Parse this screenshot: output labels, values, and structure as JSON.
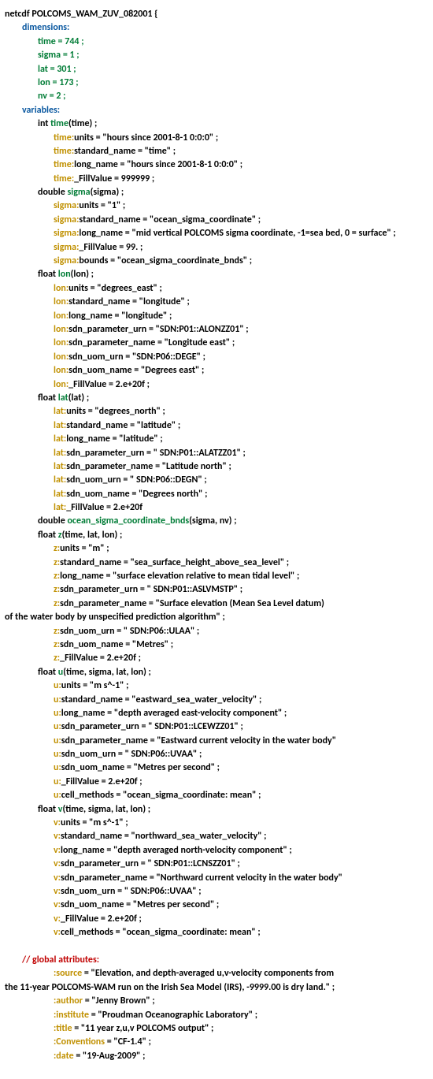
{
  "header": "netcdf POLCOMS_WAM_ZUV_082001 {",
  "section_dimensions": "dimensions:",
  "dims": {
    "time": "time = 744 ;",
    "sigma": "sigma = 1 ;",
    "lat": "lat = 301 ;",
    "lon": "lon = 173 ;",
    "nv": "nv = 2 ;"
  },
  "section_variables": "variables:",
  "vars": {
    "time_decl_prefix": "int ",
    "time_name": "time",
    "time_args": "(time) ;",
    "time_attrs": {
      "units_pref": "time:",
      "units": "units = \"hours since 2001-8-1 0:0:0\" ;",
      "std_pref": "time:",
      "std": "standard_name = \"time\" ;",
      "long_pref": "time:",
      "long": "long_name = \"hours since 2001-8-1 0:0:0\" ;",
      "fill_pref": "time:",
      "fill": "_FillValue = 999999 ;"
    },
    "sigma_decl_prefix": "double ",
    "sigma_name": "sigma",
    "sigma_args": "(sigma) ;",
    "sigma_attrs": {
      "units_pref": "sigma:",
      "units": "units = \"1\" ;",
      "std_pref": "sigma:",
      "std": "standard_name = \"ocean_sigma_coordinate\" ;",
      "long_pref": "sigma:",
      "long": "long_name = \"mid vertical POLCOMS sigma coordinate, -1=sea bed, 0 = surface\" ;",
      "fill_pref": "sigma:",
      "fill": "_FillValue = 99. ;",
      "bnds_pref": "sigma:",
      "bnds": "bounds = \"ocean_sigma_coordinate_bnds\" ;"
    },
    "lon_decl_prefix": "float ",
    "lon_name": "lon",
    "lon_args": "(lon) ;",
    "lon_attrs": {
      "units_pref": "lon:",
      "units": "units = \"degrees_east\" ;",
      "std_pref": "lon:",
      "std": "standard_name = \"longitude\" ;",
      "long_pref": "lon:",
      "long": "long_name = \"longitude\" ;",
      "purn_pref": "lon:",
      "purn": "sdn_parameter_urn = \"SDN:P01::ALONZZ01\" ;",
      "pname_pref": "lon:",
      "pname": "sdn_parameter_name = \"Longitude east\" ;",
      "uurn_pref": "lon:",
      "uurn": "sdn_uom_urn = \"SDN:P06::DEGE\" ;",
      "uname_pref": "lon:",
      "uname": "sdn_uom_name = \"Degrees east\" ;",
      "fill_pref": "lon:",
      "fill": "_FillValue = 2.e+20f ;"
    },
    "lat_decl_prefix": "float ",
    "lat_name": "lat",
    "lat_args": "(lat) ;",
    "lat_attrs": {
      "units_pref": "lat:",
      "units": "units = \"degrees_north\" ;",
      "std_pref": "lat:",
      "std": "standard_name = \"latitude\" ;",
      "long_pref": "lat:",
      "long": "long_name = \"latitude\" ;",
      "purn_pref": "lat:",
      "purn": "sdn_parameter_urn = \" SDN:P01::ALATZZ01\" ;",
      "pname_pref": "lat:",
      "pname": "sdn_parameter_name = \"Latitude north\" ;",
      "uurn_pref": "lat:",
      "uurn": "sdn_uom_urn = \" SDN:P06::DEGN\" ;",
      "uname_pref": "lat:",
      "uname": "sdn_uom_name = \"Degrees north\" ;",
      "fill_pref": "lat:",
      "fill": "_FillValue = 2.e+20f"
    },
    "oscb_decl_prefix": "double ",
    "oscb_name": "ocean_sigma_coordinate_bnds",
    "oscb_args": "(sigma, nv) ;",
    "z_decl_prefix": "float ",
    "z_name": "z",
    "z_args": "(time, lat, lon) ;",
    "z_attrs": {
      "units_pref": "z:",
      "units": "units = \"m\" ;",
      "std_pref": "z:",
      "std": "standard_name = \"sea_surface_height_above_sea_level\" ;",
      "long_pref": "z:",
      "long": "long_name = \"surface elevation relative to mean tidal level\" ;",
      "purn_pref": "z:",
      "purn": "sdn_parameter_urn = \" SDN:P01::ASLVMSTP\" ;",
      "pname_pref": "z:",
      "pname": "sdn_parameter_name = \"Surface elevation (Mean Sea Level datum)",
      "pname_cont": "of the water body by unspecified prediction algorithm\" ;",
      "uurn_pref": "z:",
      "uurn": "sdn_uom_urn = \" SDN:P06::ULAA\" ;",
      "uname_pref": "z:",
      "uname": "sdn_uom_name = \"Metres\" ;",
      "fill_pref": "z:",
      "fill": "_FillValue = 2.e+20f ;"
    },
    "u_decl_prefix": "float ",
    "u_name": "u",
    "u_args": "(time, sigma, lat, lon) ;",
    "u_attrs": {
      "units_pref": "u:",
      "units": "units = \"m s^-1\" ;",
      "std_pref": "u:",
      "std": "standard_name = \"eastward_sea_water_velocity\" ;",
      "long_pref": "u:",
      "long": "long_name = \"depth averaged east-velocity component\" ;",
      "purn_pref": "u:",
      "purn": "sdn_parameter_urn = \" SDN:P01::LCEWZZ01\" ;",
      "pname_pref": "u:",
      "pname": "sdn_parameter_name = \"Eastward current velocity in the water body\"",
      "uurn_pref": "u:",
      "uurn": "sdn_uom_urn = \" SDN:P06::UVAA\" ;",
      "uname_pref": "u:",
      "uname": "sdn_uom_name = \"Metres per second\" ;",
      "fill_pref": "u:",
      "fill": "_FillValue = 2.e+20f ;",
      "cm_pref": "u:",
      "cm": "cell_methods = \"ocean_sigma_coordinate: mean\" ;"
    },
    "v_decl_prefix": "float ",
    "v_name": "v",
    "v_args": "(time, sigma, lat, lon) ;",
    "v_attrs": {
      "units_pref": "v:",
      "units": "units = \"m s^-1\" ;",
      "std_pref": "v:",
      "std": "standard_name = \"northward_sea_water_velocity\" ;",
      "long_pref": "v:",
      "long": "long_name = \"depth averaged north-velocity component\" ;",
      "purn_pref": "v:",
      "purn": "sdn_parameter_urn = \" SDN:P01::LCNSZZ01\" ;",
      "pname_pref": "v:",
      "pname": "sdn_parameter_name = \"Northward current velocity in the water body\"",
      "uurn_pref": "v:",
      "uurn": "sdn_uom_urn = \" SDN:P06::UVAA\" ;",
      "uname_pref": "v:",
      "uname": "sdn_uom_name = \"Metres per second\" ;",
      "fill_pref": "v:",
      "fill": "_FillValue = 2.e+20f ;",
      "cm_pref": "v:",
      "cm": "cell_methods = \"ocean_sigma_coordinate: mean\" ;"
    }
  },
  "global_comment": "// global attributes:",
  "globals": {
    "source_pref": ":source",
    "source1": " = \"Elevation, and depth-averaged u,v-velocity components from",
    "source2": "the 11-year POLCOMS-WAM run on the Irish Sea Model (IRS), -9999.00 is dry land.\" ;",
    "author_pref": ":author",
    "author": " = \"Jenny Brown\" ;",
    "inst_pref": ":institute",
    "inst": " = \"Proudman Oceanographic Laboratory\" ;",
    "title_pref": ":title",
    "title": " = \"11 year z,u,v POLCOMS output\" ;",
    "conv_pref": ":Conventions",
    "conv": " = \"CF-1.4\" ;",
    "date_pref": ":date",
    "date": " = \"19-Aug-2009\" ;"
  }
}
